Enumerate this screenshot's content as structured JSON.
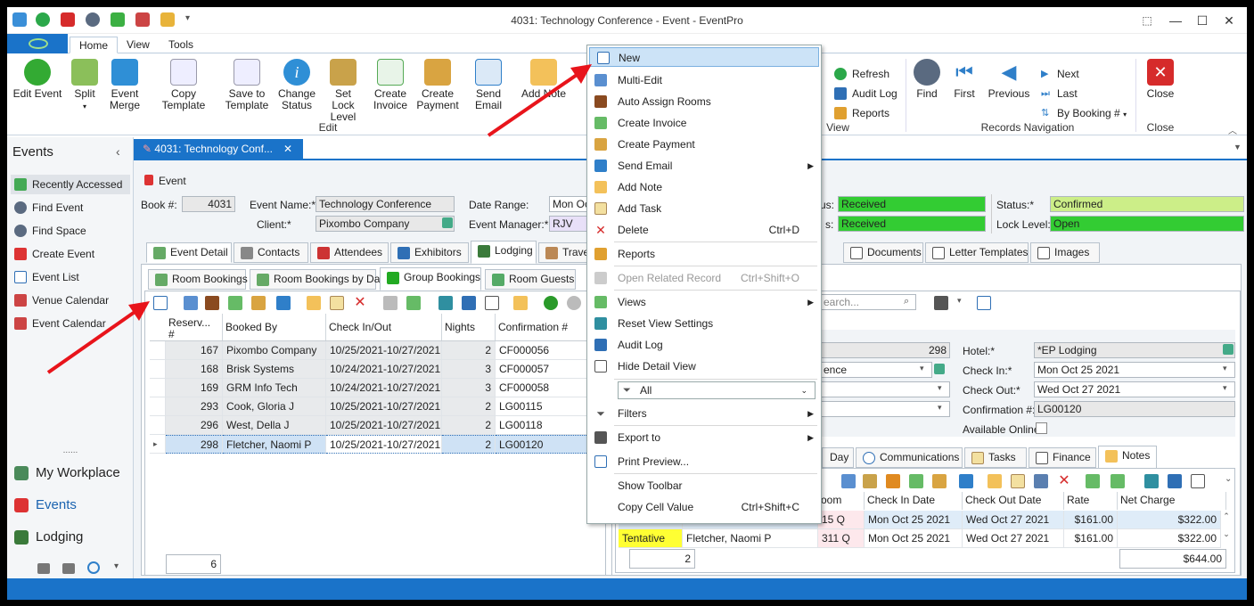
{
  "window": {
    "title": "4031: Technology Conference - Event - EventPro"
  },
  "ribbon_tabs": [
    "Home",
    "View",
    "Tools"
  ],
  "ribbon": {
    "buttons": [
      "Edit Event",
      "Split",
      "Event Merge",
      "Copy Template",
      "Save to Template",
      "Change Status",
      "Set Lock Level",
      "Create Invoice",
      "Create Payment",
      "Send Email",
      "Add Note"
    ],
    "edit_group": "Edit",
    "view_items": [
      "Refresh",
      "Audit Log",
      "Reports"
    ],
    "view_group": "View",
    "nav_buttons": [
      "Find",
      "First",
      "Previous"
    ],
    "nav_small": [
      "Next",
      "Last",
      "By Booking #"
    ],
    "nav_group": "Records Navigation",
    "close_button": "Close",
    "close_group": "Close"
  },
  "nav_panel": {
    "title": "Events",
    "items": [
      "Recently Accessed",
      "Find Event",
      "Find Space",
      "Create Event",
      "Event List",
      "Venue Calendar",
      "Event Calendar"
    ],
    "grip": "......",
    "bottom": [
      "My Workplace",
      "Events",
      "Lodging"
    ]
  },
  "doc_tab": {
    "label": "4031: Technology Conf...",
    "close": "✕"
  },
  "event": {
    "section": "Event",
    "book_label": "Book #:",
    "book_value": "4031",
    "name_label": "Event Name:*",
    "name_value": "Technology Conference",
    "client_label": "Client:*",
    "client_value": "Pixombo Company",
    "date_label": "Date Range:",
    "date_value": "Mon Oct",
    "manager_label": "Event Manager:*",
    "manager_value": "RJV",
    "status_a_label": "us:",
    "status_a_value": "Received",
    "status_b_label": "s:",
    "status_b_value": "Received",
    "status_label": "Status:*",
    "status_value": "Confirmed",
    "lock_label": "Lock Level:",
    "lock_value": "Open"
  },
  "main_tabs": [
    "Event Detail",
    "Contacts",
    "Attendees",
    "Exhibitors",
    "Lodging",
    "Travel",
    "Documents",
    "Letter Templates",
    "Images"
  ],
  "sub_tabs": [
    "Room Bookings",
    "Room Bookings by Day",
    "Group Bookings",
    "Room Guests"
  ],
  "grid": {
    "headers": [
      "Reserv... #",
      "Booked By",
      "Check In/Out",
      "Nights",
      "Confirmation #"
    ],
    "rows": [
      {
        "id": "167",
        "by": "Pixombo Company",
        "dates": "10/25/2021-10/27/2021",
        "nights": "2",
        "conf": "CF000056"
      },
      {
        "id": "168",
        "by": "Brisk Systems",
        "dates": "10/24/2021-10/27/2021",
        "nights": "3",
        "conf": "CF000057"
      },
      {
        "id": "169",
        "by": "GRM Info Tech",
        "dates": "10/24/2021-10/27/2021",
        "nights": "3",
        "conf": "CF000058"
      },
      {
        "id": "293",
        "by": "Cook, Gloria J",
        "dates": "10/25/2021-10/27/2021",
        "nights": "2",
        "conf": "LG00115"
      },
      {
        "id": "296",
        "by": "West, Della J",
        "dates": "10/25/2021-10/27/2021",
        "nights": "2",
        "conf": "LG00118"
      },
      {
        "id": "298",
        "by": "Fletcher, Naomi P",
        "dates": "10/25/2021-10/27/2021",
        "nights": "2",
        "conf": "LG00120"
      }
    ],
    "count": "6",
    "row_marker": "▸"
  },
  "detail": {
    "search_placeholder": "earch...",
    "id_value": "298",
    "field2": "ence",
    "hotel_label": "Hotel:*",
    "hotel_value": "*EP Lodging",
    "checkin_label": "Check In:*",
    "checkin_value": "Mon Oct 25 2021",
    "checkout_label": "Check Out:*",
    "checkout_value": "Wed Oct 27 2021",
    "conf_label": "Confirmation #:",
    "conf_value": "LG00120",
    "online_label": "Available Online",
    "tabs": [
      "Day",
      "Communications",
      "Tasks",
      "Finance",
      "Notes"
    ],
    "headers": [
      "oom",
      "Check In Date",
      "Check Out Date",
      "Rate",
      "Net Charge"
    ],
    "rows": [
      {
        "status": "",
        "guest": "",
        "room": "15 Q",
        "in": "Mon Oct 25 2021",
        "out": "Wed Oct 27 2021",
        "rate": "$161.00",
        "net": "$322.00"
      },
      {
        "status": "Tentative",
        "guest": "Fletcher, Naomi P",
        "room": "311 Q",
        "in": "Mon Oct 25 2021",
        "out": "Wed Oct 27 2021",
        "rate": "$161.00",
        "net": "$322.00"
      }
    ],
    "count": "2",
    "total": "$644.00"
  },
  "context_menu": {
    "items": [
      {
        "label": "New",
        "shortcut": ""
      },
      {
        "label": "Multi-Edit",
        "shortcut": ""
      },
      {
        "label": "Auto Assign Rooms",
        "shortcut": ""
      },
      {
        "label": "Create Invoice",
        "shortcut": ""
      },
      {
        "label": "Create Payment",
        "shortcut": ""
      },
      {
        "label": "Send Email",
        "shortcut": ""
      },
      {
        "label": "Add Note",
        "shortcut": ""
      },
      {
        "label": "Add Task",
        "shortcut": ""
      },
      {
        "label": "Delete",
        "shortcut": "Ctrl+D"
      },
      {
        "label": "Reports",
        "shortcut": ""
      },
      {
        "label": "Open Related Record",
        "shortcut": "Ctrl+Shift+O"
      },
      {
        "label": "Views",
        "shortcut": ""
      },
      {
        "label": "Reset View Settings",
        "shortcut": ""
      },
      {
        "label": "Audit Log",
        "shortcut": ""
      },
      {
        "label": "Hide Detail View",
        "shortcut": ""
      },
      {
        "label": "All",
        "shortcut": ""
      },
      {
        "label": "Filters",
        "shortcut": ""
      },
      {
        "label": "Export to",
        "shortcut": ""
      },
      {
        "label": "Print Preview...",
        "shortcut": ""
      },
      {
        "label": "Show Toolbar",
        "shortcut": ""
      },
      {
        "label": "Copy Cell Value",
        "shortcut": "Ctrl+Shift+C"
      }
    ]
  },
  "colors": {
    "accent": "#1a73c9",
    "green_status": "#33cc33",
    "confirmed": "#ccee88",
    "tentative": "#ffff33",
    "annotation_arrow": "#e8141b"
  }
}
